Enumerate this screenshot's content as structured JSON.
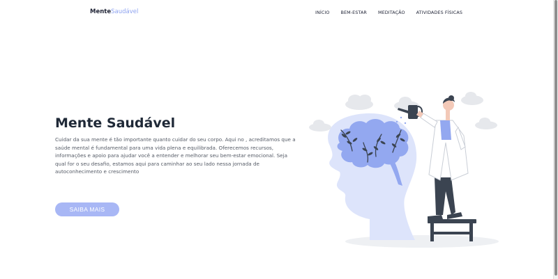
{
  "header": {
    "logo_part1": "Mente",
    "logo_part2": "Saudável",
    "nav": [
      "INÍCIO",
      "BEM-ESTAR",
      "MEDITAÇÃO",
      "ATIVIDADES FÍSICAS"
    ]
  },
  "hero": {
    "title": "Mente Saudável",
    "description": "Cuidar da sua mente é tão importante quanto cuidar do seu corpo. Aqui no , acreditamos que a saúde mental é fundamental para uma vida plena e equilibrada. Oferecemos recursos, informações e apoio para ajudar você a entender e melhorar seu bem-estar emocional. Seja qual for o seu desafio, estamos aqui para caminhar ao seu lado nessa jornada de autoconhecimento e crescimento",
    "cta_label": "SAIBA MAIS"
  },
  "colors": {
    "accent": "#a8b7f5",
    "logo_accent": "#8ea3f0",
    "text_dark": "#1f2937",
    "head_light": "#dde4fb",
    "brain": "#93a8f0",
    "figure_dark": "#3b4451"
  },
  "illustration": {
    "icon": "mental-health-illustration"
  }
}
